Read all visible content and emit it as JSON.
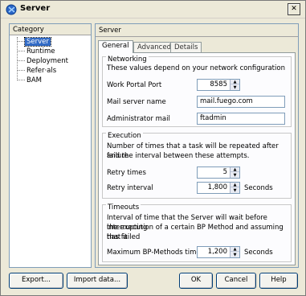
{
  "window": {
    "title": "Server",
    "close_glyph": "✕"
  },
  "category": {
    "header": "Category",
    "items": [
      {
        "label": "Server",
        "selected": true
      },
      {
        "label": "Runtime"
      },
      {
        "label": "Deployment"
      },
      {
        "label": "Refer·als"
      },
      {
        "label": "BAM"
      }
    ]
  },
  "settings": {
    "header": "Server",
    "tabs": [
      "General",
      "Advanced",
      "Details"
    ],
    "networking": {
      "title": "Networking",
      "description": "These values depend on your network configuration",
      "work_portal_port_label": "Work Portal Port",
      "work_portal_port_value": "8585",
      "mail_server_label": "Mail server name",
      "mail_server_value": "mail.fuego.com",
      "admin_mail_label": "Administrator mail",
      "admin_mail_value": "ftadmin"
    },
    "execution": {
      "title": "Execution",
      "description_line1": "Number of times that a task will be repeated after failure",
      "description_line2": "and the interval between these attempts.",
      "retry_times_label": "Retry times",
      "retry_times_value": "5",
      "retry_interval_label": "Retry interval",
      "retry_interval_value": "1,800",
      "retry_interval_unit": "Seconds"
    },
    "timeouts": {
      "title": "Timeouts",
      "description_line1": "Interval of time that the Server will wait before interrupting",
      "description_line2": "the execution of a certain BP Method and assuming that it",
      "description_line3": "has failed",
      "max_bp_label": "Maximum BP-Methods time...",
      "max_bp_value": "1,200",
      "max_bp_unit": "Seconds"
    }
  },
  "buttons": {
    "export": "Export...",
    "import": "Import data...",
    "ok": "OK",
    "cancel": "Cancel",
    "help": "Help"
  },
  "icons": {
    "app": "server-app-icon",
    "close": "close-icon",
    "spin_up": "spin-up-icon",
    "spin_down": "spin-down-icon"
  }
}
